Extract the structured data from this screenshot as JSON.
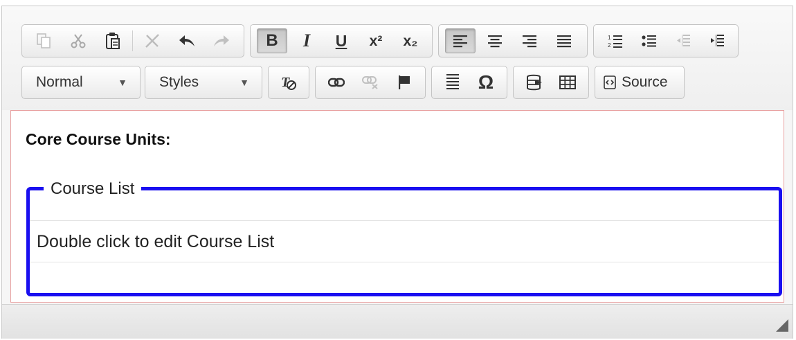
{
  "toolbar": {
    "row1": {
      "clipboard": [
        "copy-icon",
        "cut-icon",
        "paste-icon",
        "remove-format-icon",
        "undo-icon",
        "redo-icon"
      ],
      "bold": "B",
      "italic": "I",
      "underline": "U",
      "superscript": "x²",
      "subscript": "x₂",
      "align": [
        "align-left-icon",
        "align-center-icon",
        "align-right-icon",
        "align-justify-icon"
      ],
      "lists": [
        "numbered-list-icon",
        "bulleted-list-icon",
        "outdent-icon",
        "indent-icon"
      ]
    },
    "row2": {
      "format_value": "Normal",
      "styles_value": "Styles",
      "omega": "Ω",
      "source_label": "Source"
    }
  },
  "content": {
    "heading": "Core Course Units:",
    "fieldset_legend": "Course List",
    "placeholder": "Double click to edit Course List"
  },
  "colors": {
    "fieldset_border": "#1a0ff0",
    "content_border": "#e8a0a0"
  }
}
